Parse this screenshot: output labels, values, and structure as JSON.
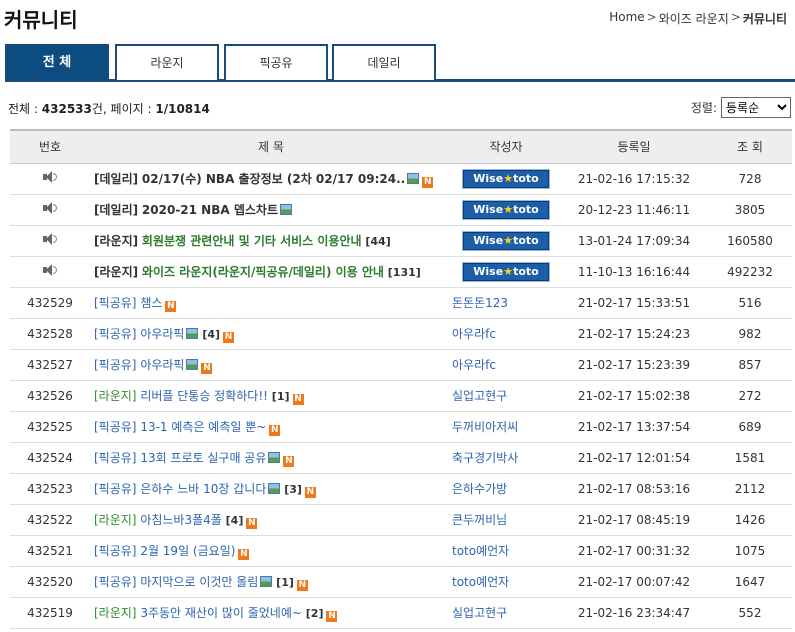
{
  "header": {
    "title": "커뮤니티",
    "breadcrumb": [
      "Home",
      "와이즈 라운지",
      "커뮤니티"
    ]
  },
  "tabs": [
    {
      "label": "전 체",
      "active": true
    },
    {
      "label": "라운지",
      "active": false
    },
    {
      "label": "픽공유",
      "active": false
    },
    {
      "label": "데일리",
      "active": false
    }
  ],
  "summary": {
    "total_label": "전체 :",
    "total": "432533",
    "total_unit": "건, 페이지 :",
    "page": "1/10814"
  },
  "sort": {
    "label": "정렬:",
    "selected": "등록순"
  },
  "table": {
    "headers": [
      "번호",
      "제 목",
      "작성자",
      "등록일",
      "조 회"
    ],
    "notices": [
      {
        "category": "[데일리]",
        "cat": "daily",
        "title": "02/17(수) NBA 출장정보 (2차 02/17 09:24..",
        "img": true,
        "new": true,
        "comments": "",
        "author": "Wise★toto",
        "date": "21-02-16 17:15:32",
        "views": "728"
      },
      {
        "category": "[데일리]",
        "cat": "daily",
        "title": "2020-21 NBA 뎁스차트",
        "img": true,
        "new": false,
        "comments": "",
        "author": "Wise★toto",
        "date": "20-12-23 11:46:11",
        "views": "3805"
      },
      {
        "category": "[라운지]",
        "cat": "lounge",
        "title": "회원분쟁 관련안내 및 기타 서비스 이용안내",
        "img": false,
        "new": false,
        "comments": "[44]",
        "author": "Wise★toto",
        "date": "13-01-24 17:09:34",
        "views": "160580"
      },
      {
        "category": "[라운지]",
        "cat": "lounge",
        "title": "와이즈 라운지(라운지/픽공유/데일리) 이용 안내",
        "img": false,
        "new": false,
        "comments": "[131]",
        "author": "Wise★toto",
        "date": "11-10-13 16:16:44",
        "views": "492232"
      }
    ],
    "posts": [
      {
        "num": "432529",
        "category": "[픽공유]",
        "cat": "pick",
        "title": "챔스",
        "img": false,
        "comments": "",
        "new": true,
        "author": "돈돈돈123",
        "date": "21-02-17 15:33:51",
        "views": "516"
      },
      {
        "num": "432528",
        "category": "[픽공유]",
        "cat": "pick",
        "title": "아우라픽",
        "img": true,
        "comments": "[4]",
        "new": true,
        "author": "아우라fc",
        "date": "21-02-17 15:24:23",
        "views": "982"
      },
      {
        "num": "432527",
        "category": "[픽공유]",
        "cat": "pick",
        "title": "아우라픽",
        "img": true,
        "comments": "",
        "new": true,
        "author": "아우라fc",
        "date": "21-02-17 15:23:39",
        "views": "857"
      },
      {
        "num": "432526",
        "category": "[라운지]",
        "cat": "lounge",
        "title": "리버플 단통승 정확하다!!",
        "img": false,
        "comments": "[1]",
        "new": true,
        "author": "실업고현구",
        "date": "21-02-17 15:02:38",
        "views": "272"
      },
      {
        "num": "432525",
        "category": "[픽공유]",
        "cat": "pick",
        "title": "13-1 예측은 예측일 뿐~",
        "img": false,
        "comments": "",
        "new": true,
        "author": "두꺼비아저씨",
        "date": "21-02-17 13:37:54",
        "views": "689"
      },
      {
        "num": "432524",
        "category": "[픽공유]",
        "cat": "pick",
        "title": "13회 프로토 실구매 공유",
        "img": true,
        "comments": "",
        "new": true,
        "author": "축구경기박사",
        "date": "21-02-17 12:01:54",
        "views": "1581"
      },
      {
        "num": "432523",
        "category": "[픽공유]",
        "cat": "pick",
        "title": "은하수 느바 10장 갑니다",
        "img": true,
        "comments": "[3]",
        "new": true,
        "author": "은하수가방",
        "date": "21-02-17 08:53:16",
        "views": "2112"
      },
      {
        "num": "432522",
        "category": "[라운지]",
        "cat": "lounge",
        "title": "아침느바3폴4폴",
        "img": false,
        "comments": "[4]",
        "new": true,
        "author": "큰두꺼비님",
        "date": "21-02-17 08:45:19",
        "views": "1426"
      },
      {
        "num": "432521",
        "category": "[픽공유]",
        "cat": "pick",
        "title": "2월 19일 (금요일)",
        "img": false,
        "comments": "",
        "new": true,
        "author": "toto예언자",
        "date": "21-02-17 00:31:32",
        "views": "1075"
      },
      {
        "num": "432520",
        "category": "[픽공유]",
        "cat": "pick",
        "title": "마지막으로 이것만 올림",
        "img": true,
        "comments": "[1]",
        "new": true,
        "author": "toto예언자",
        "date": "21-02-17 00:07:42",
        "views": "1647"
      },
      {
        "num": "432519",
        "category": "[라운지]",
        "cat": "lounge",
        "title": "3주동안 재산이 많이 줄었네예~",
        "img": false,
        "comments": "[2]",
        "new": true,
        "author": "실업고현구",
        "date": "21-02-16 23:34:47",
        "views": "552"
      }
    ]
  },
  "icons": {
    "new_label": "N",
    "notice": "speaker-icon",
    "image": "image-icon"
  },
  "colors": {
    "tab_active": "#0d4c80",
    "daily": "#d0621a",
    "lounge": "#2e8b2e",
    "pick": "#2c64b0",
    "new_badge": "#f07818"
  }
}
